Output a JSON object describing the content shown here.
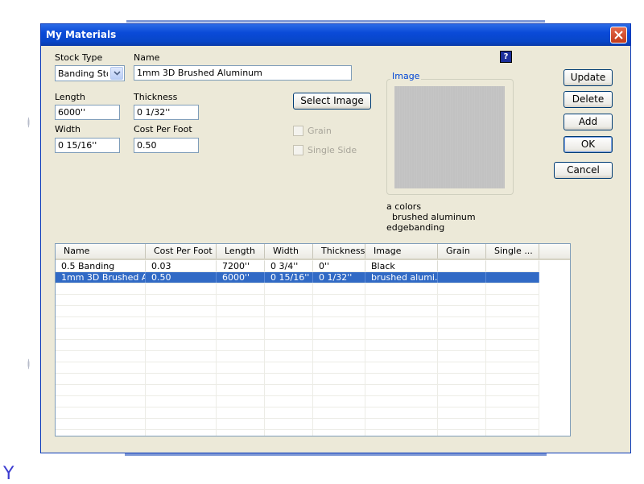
{
  "dialog": {
    "title": "My Materials",
    "help_label": "?"
  },
  "form": {
    "stock_type_label": "Stock Type",
    "stock_type_value": "Banding Stoc",
    "name_label": "Name",
    "name_value": "1mm 3D Brushed Aluminum",
    "length_label": "Length",
    "length_value": "6000''",
    "thickness_label": "Thickness",
    "thickness_value": "0 1/32''",
    "width_label": "Width",
    "width_value": "0 15/16''",
    "cost_label": "Cost Per Foot",
    "cost_value": "0.50",
    "select_image_label": "Select Image",
    "grain_label": "Grain",
    "single_side_label": "Single Side"
  },
  "image_group": {
    "title": "Image",
    "description_lines": [
      "a colors",
      "  brushed aluminum",
      "edgebanding"
    ]
  },
  "buttons": {
    "update": "Update",
    "delete": "Delete",
    "add": "Add",
    "ok": "OK",
    "cancel": "Cancel"
  },
  "table": {
    "columns": [
      "Name",
      "Cost Per Foot",
      "Length",
      "Width",
      "Thickness",
      "Image",
      "Grain",
      "Single ..."
    ],
    "rows": [
      {
        "cells": [
          "0.5 Banding",
          "0.03",
          "7200''",
          "0 3/4''",
          "0''",
          "Black",
          "",
          ""
        ],
        "selected": false
      },
      {
        "cells": [
          "1mm 3D Brushed Al...",
          "0.50",
          "6000''",
          "0 15/16''",
          "0 1/32''",
          "brushed alumi...",
          "",
          ""
        ],
        "selected": true
      }
    ]
  },
  "background": {
    "axis_label": "Y"
  },
  "colors": {
    "title_bar": "#0a4ad8",
    "selection": "#316ac5",
    "dialog_bg": "#ece9d8",
    "close_button": "#c23a1a"
  }
}
